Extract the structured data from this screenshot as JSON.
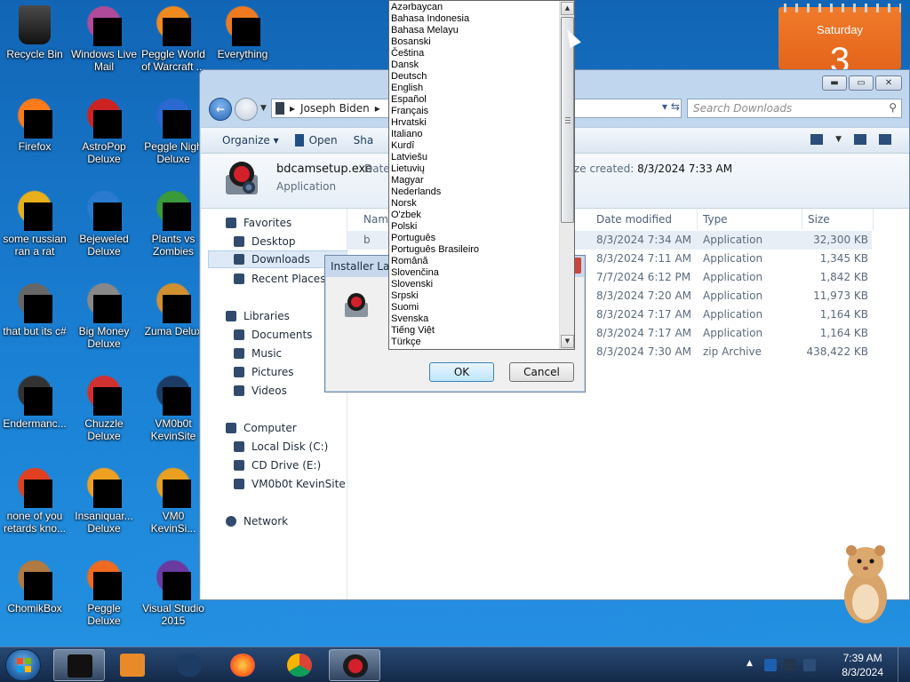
{
  "desktop_icons": [
    {
      "label": "Recycle Bin",
      "icon": "recycle-bin-icon"
    },
    {
      "label": "Windows Live\nMail",
      "icon": "windows-live-mail-icon"
    },
    {
      "label": "Peggle World\nof Warcraft ...",
      "icon": "peggle-wow-icon"
    },
    {
      "label": "Everything",
      "icon": "everything-icon"
    },
    {
      "label": "Firefox",
      "icon": "firefox-icon"
    },
    {
      "label": "AstroPop\nDeluxe",
      "icon": "astropop-icon"
    },
    {
      "label": "Peggle Nigh\nDeluxe",
      "icon": "peggle-nights-icon"
    },
    {
      "label": "some russian\nran a rat",
      "icon": "rat-icon"
    },
    {
      "label": "Bejeweled\nDeluxe",
      "icon": "bejeweled-icon"
    },
    {
      "label": "Plants vs\nZombies",
      "icon": "pvz-icon"
    },
    {
      "label": "that but its c#",
      "icon": "csharp-icon"
    },
    {
      "label": "Big Money\nDeluxe",
      "icon": "big-money-icon"
    },
    {
      "label": "Zuma Delux",
      "icon": "zuma-icon"
    },
    {
      "label": "Endermanc...",
      "icon": "enderman-icon"
    },
    {
      "label": "Chuzzle\nDeluxe",
      "icon": "chuzzle-icon"
    },
    {
      "label": "VM0b0t\nKevinSite",
      "icon": "vm-icon"
    },
    {
      "label": "none of you\nretards kno...",
      "icon": "chrome-icon"
    },
    {
      "label": "Insaniquar...\nDeluxe",
      "icon": "insaniquarium-icon"
    },
    {
      "label": "VM0\nKevinSi...",
      "icon": "vm-chrome-icon"
    },
    {
      "label": "ChomikBox",
      "icon": "chomikbox-icon"
    },
    {
      "label": "Peggle Deluxe",
      "icon": "peggle-icon"
    },
    {
      "label": "Visual Studio\n2015",
      "icon": "visual-studio-icon"
    }
  ],
  "gadget": {
    "day": "Saturday",
    "date_num": "3"
  },
  "explorer": {
    "address_path": "Joseph Biden",
    "search_placeholder": "Search Downloads",
    "toolbar": {
      "organize": "Organize",
      "open": "Open",
      "share": "Sha"
    },
    "details": {
      "file_name": "bdcamsetup.exe",
      "file_type": "Application",
      "date_label": "Date",
      "created_label": "ze created:",
      "created_value": "8/3/2024 7:33 AM"
    },
    "nav": {
      "favorites": "Favorites",
      "desktop": "Desktop",
      "downloads": "Downloads",
      "recent_places": "Recent Places",
      "libraries": "Libraries",
      "documents": "Documents",
      "music": "Music",
      "pictures": "Pictures",
      "videos": "Videos",
      "computer": "Computer",
      "local_disk": "Local Disk (C:)",
      "cd_drive": "CD Drive (E:)",
      "vm_share": "VM0b0t KevinSite",
      "network": "Network"
    },
    "columns": {
      "name": "Nam",
      "date_modified": "Date modified",
      "type": "Type",
      "size": "Size"
    },
    "files": [
      {
        "name": "b",
        "date": "8/3/2024 7:34 AM",
        "type": "Application",
        "size": "32,300 KB"
      },
      {
        "name": "",
        "date": "8/3/2024 7:11 AM",
        "type": "Application",
        "size": "1,345 KB"
      },
      {
        "name": "",
        "date": "7/7/2024 6:12 PM",
        "type": "Application",
        "size": "1,842 KB"
      },
      {
        "name": "",
        "date": "8/3/2024 7:20 AM",
        "type": "Application",
        "size": "11,973 KB"
      },
      {
        "name": "",
        "date": "8/3/2024 7:17 AM",
        "type": "Application",
        "size": "1,164 KB"
      },
      {
        "name": "",
        "date": "8/3/2024 7:17 AM",
        "type": "Application",
        "size": "1,164 KB"
      },
      {
        "name": "",
        "date": "8/3/2024 7:30 AM",
        "type": "zip Archive",
        "size": "438,422 KB"
      }
    ]
  },
  "installer": {
    "title": "Installer Lan",
    "ok": "OK",
    "cancel": "Cancel"
  },
  "languages": [
    "Azərbaycan",
    "Bahasa Indonesia",
    "Bahasa Melayu",
    "Bosanski",
    "Čeština",
    "Dansk",
    "Deutsch",
    "English",
    "Español",
    "Français",
    "Hrvatski",
    "Italiano",
    "Kurdî",
    "Latviešu",
    "Lietuvių",
    "Magyar",
    "Nederlands",
    "Norsk",
    "O'zbek",
    "Polski",
    "Português",
    "Português Brasileiro",
    "Română",
    "Slovenčina",
    "Slovenski",
    "Srpski",
    "Suomi",
    "Svenska",
    "Tiếng Việt",
    "Türkçe"
  ],
  "taskbar": {
    "time": "7:39 AM",
    "date": "8/3/2024",
    "show_hidden_icons": "▲"
  },
  "colors": {
    "desktop_blue": "#1a73c4",
    "gadget_orange": "#e4641c"
  }
}
